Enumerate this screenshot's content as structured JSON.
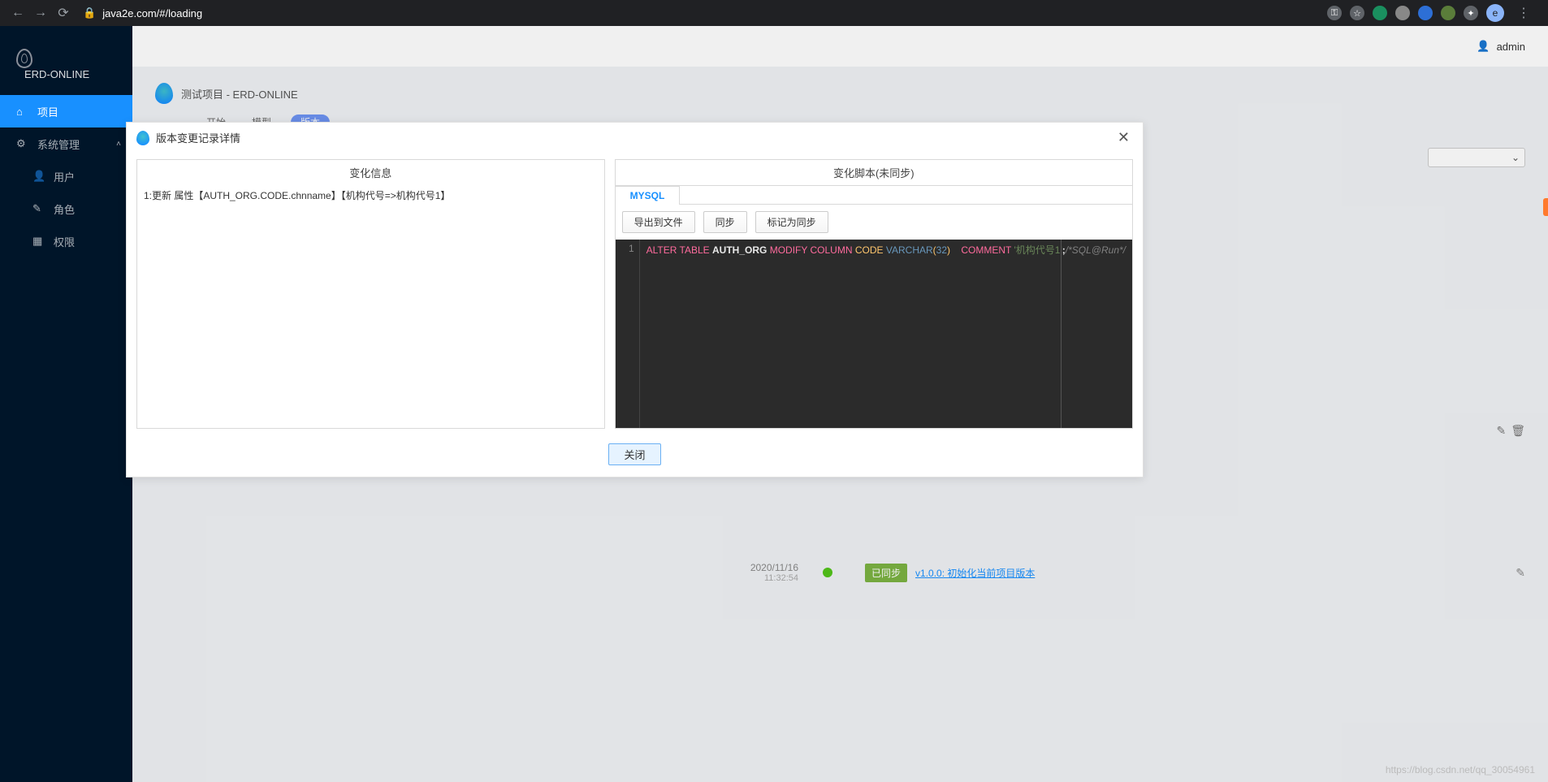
{
  "browser": {
    "url": "java2e.com/#/loading",
    "avatar_letter": "e"
  },
  "sidebar": {
    "brand": "ERD-ONLINE",
    "items": {
      "project": "项目",
      "system": "系统管理",
      "user": "用户",
      "role": "角色",
      "permission": "权限"
    }
  },
  "topbar": {
    "username": "admin"
  },
  "breadcrumb": {
    "text": "测试项目 - ERD-ONLINE"
  },
  "tabs": {
    "start": "开始",
    "model": "模型",
    "version": "版本"
  },
  "timeline": {
    "date": "2020/11/16",
    "time": "11:32:54",
    "badge": "已同步",
    "link": "v1.0.0: 初始化当前项目版本"
  },
  "modal": {
    "title": "版本变更记录详情",
    "left_title": "变化信息",
    "change_line": "1:更新 属性【AUTH_ORG.CODE.chnname】【机构代号=>机构代号1】",
    "right_title": "变化脚本(未同步)",
    "db_tab": "MYSQL",
    "btn_export": "导出到文件",
    "btn_sync": "同步",
    "btn_mark": "标记为同步",
    "sql": {
      "line_no": "1",
      "alter": "ALTER",
      "table": "TABLE",
      "tname": "AUTH_ORG",
      "modify": "MODIFY",
      "column": "COLUMN",
      "col": "CODE",
      "type": "VARCHAR",
      "lp": "(",
      "size": "32",
      "rp": ")",
      "comment_kw": "COMMENT",
      "comment_val": "'机构代号1'",
      "semi": ";",
      "tail": "/*SQL@Run*/"
    },
    "close": "关闭"
  },
  "watermark": "https://blog.csdn.net/qq_30054961"
}
